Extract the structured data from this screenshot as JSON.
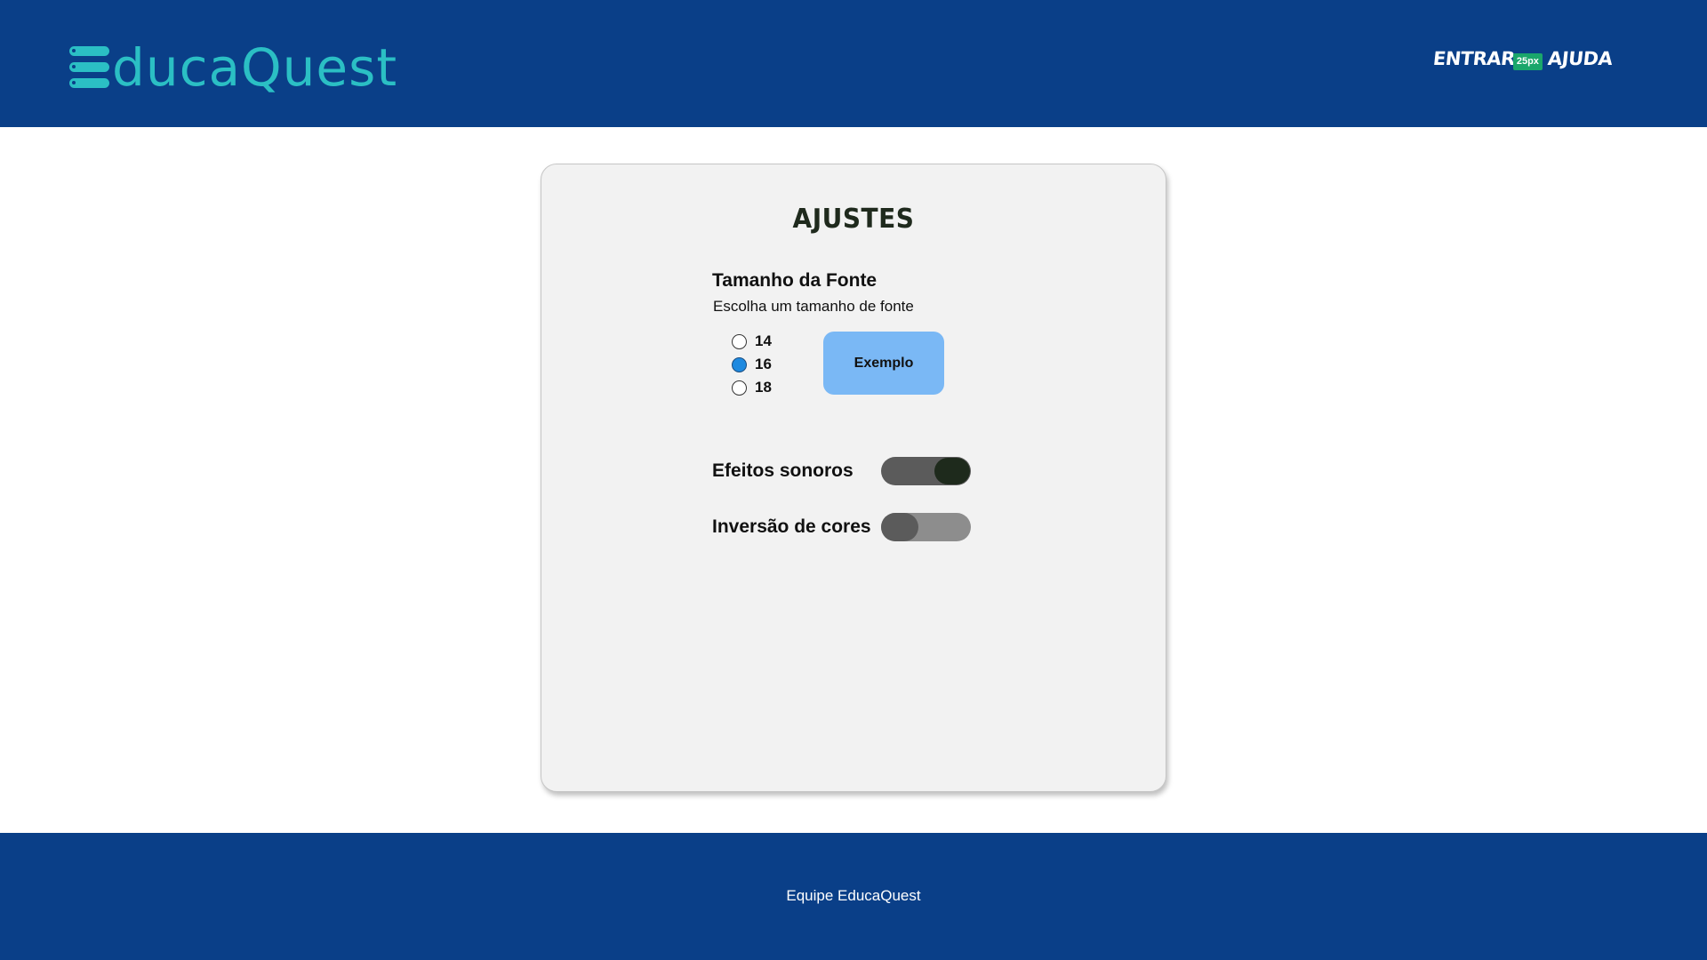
{
  "header": {
    "logo_text": "ducaQuest",
    "nav": {
      "login_label": "ENTRAR",
      "font_size_badge": "25px",
      "help_label": "AJUDA"
    }
  },
  "settings": {
    "title": "AJUSTES",
    "font_size": {
      "title": "Tamanho da Fonte",
      "subtitle": "Escolha um tamanho de fonte",
      "options": [
        "14",
        "16",
        "18"
      ],
      "selected": "16",
      "example_label": "Exemplo"
    },
    "toggles": [
      {
        "label": "Efeitos sonoros",
        "state": "on"
      },
      {
        "label": "Inversão de cores",
        "state": "off"
      }
    ]
  },
  "footer": {
    "text": "Equipe EducaQuest"
  },
  "colors": {
    "brand_blue": "#0a3f88",
    "logo_teal": "#2bbfc4",
    "badge_green": "#1aa66b",
    "radio_checked": "#1f8ae0",
    "example_button": "#7ab8f5"
  }
}
